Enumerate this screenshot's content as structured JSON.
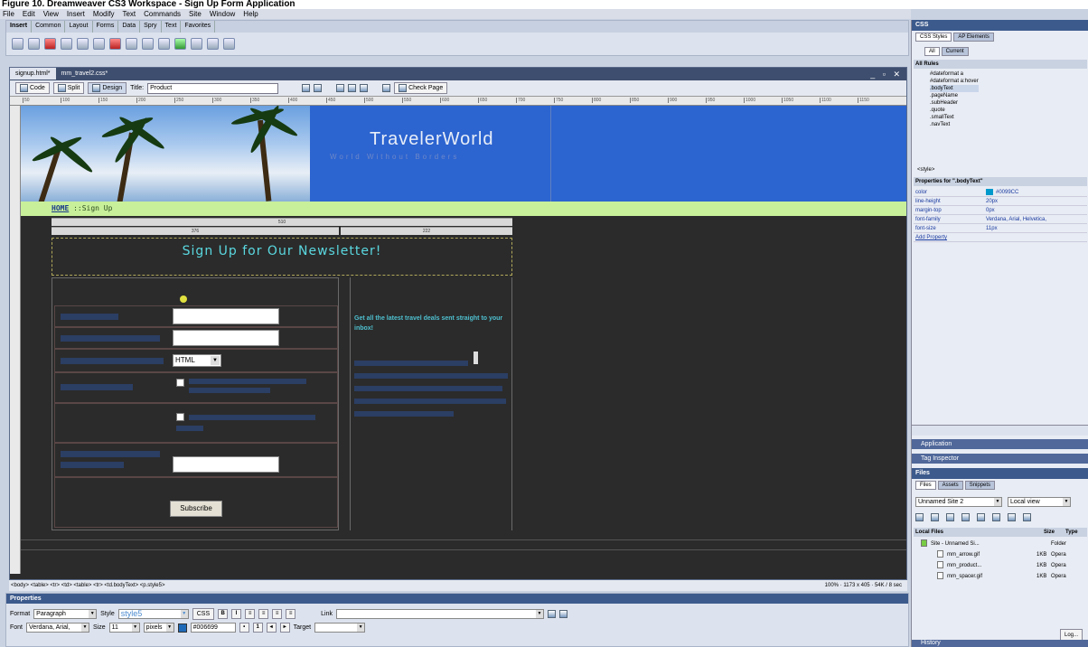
{
  "caption": "Figure 10. Dreamweaver CS3 Workspace - Sign Up Form Application",
  "menu": [
    "File",
    "Edit",
    "View",
    "Insert",
    "Modify",
    "Text",
    "Commands",
    "Site",
    "Window",
    "Help"
  ],
  "insert_tabs": [
    "Insert",
    "Common",
    "Layout",
    "Forms",
    "Data",
    "Spry",
    "Text",
    "Favorites"
  ],
  "doc_tabs": [
    "signup.html*",
    "mm_travel2.css*"
  ],
  "doc_toolbar": {
    "code": "Code",
    "split": "Split",
    "design": "Design",
    "title_label": "Title:",
    "title_value": "Product",
    "check_page": "Check Page"
  },
  "ruler_ticks": [
    "50",
    "100",
    "150",
    "200",
    "250",
    "300",
    "350",
    "400",
    "450",
    "500",
    "550",
    "600",
    "650",
    "700",
    "750",
    "800",
    "850",
    "900",
    "950",
    "1000",
    "1050",
    "1100",
    "1150"
  ],
  "banner": {
    "brand": "TravelerWorld",
    "tagline": "World Without Borders"
  },
  "nav": {
    "home": "HOME",
    "current": "::Sign Up"
  },
  "width_labels": {
    "total": "510",
    "left": "376",
    "right": "222"
  },
  "form": {
    "headline": "Sign Up for Our Newsletter!",
    "format_select": "HTML",
    "subscribe": "Subscribe"
  },
  "sidebar": {
    "promo": "Get all the latest travel deals sent straight to your inbox!"
  },
  "status": {
    "tags": "<body> <table> <tr> <td> <table> <tr> <td.bodyText> <p.style5>",
    "zoom": "100%",
    "size": "1173 x 405",
    "weight": "54K / 8 sec"
  },
  "properties": {
    "header": "Properties",
    "format_label": "Format",
    "format_value": "Paragraph",
    "style_label": "Style",
    "style_value": "style5",
    "css_button": "CSS",
    "link_label": "Link",
    "font_label": "Font",
    "font_value": "Verdana, Arial,",
    "size_label": "Size",
    "size_value": "11",
    "unit_value": "pixels",
    "color_value": "#006699",
    "target_label": "Target"
  },
  "css_panel": {
    "header": "CSS",
    "tabs": [
      "CSS Styles",
      "AP Elements"
    ],
    "mode_tabs": [
      "All",
      "Current"
    ],
    "all_rules": "All Rules",
    "rules": [
      "#dateformat a",
      "#dateformat a:hover",
      ".bodyText",
      ".pageName",
      ".subHeader",
      ".quote",
      ".smallText",
      ".navText"
    ],
    "style_tag": "<style>",
    "props_title": "Properties for \".bodyText\"",
    "props": [
      {
        "k": "color",
        "v": "#0099CC"
      },
      {
        "k": "line-height",
        "v": "20px"
      },
      {
        "k": "margin-top",
        "v": "0px"
      },
      {
        "k": "font-family",
        "v": "Verdana, Arial, Helvetica,"
      },
      {
        "k": "font-size",
        "v": "11px"
      }
    ],
    "add_property": "Add Property"
  },
  "panels": {
    "application": "Application",
    "tag_inspector": "Tag Inspector",
    "files": "Files",
    "history": "History"
  },
  "files_panel": {
    "tabs": [
      "Files",
      "Assets",
      "Snippets"
    ],
    "site": "Unnamed Site 2",
    "view": "Local view",
    "local_files": "Local Files",
    "size_col": "Size",
    "type_col": "Type",
    "rows": [
      {
        "name": "Site - Unnamed Si...",
        "size": "",
        "type": "Folder"
      },
      {
        "name": "mm_arrow.gif",
        "size": "1KB",
        "type": "Opera"
      },
      {
        "name": "mm_product...",
        "size": "1KB",
        "type": "Opera"
      },
      {
        "name": "mm_spacer.gif",
        "size": "1KB",
        "type": "Opera"
      }
    ],
    "log": "Log..."
  },
  "colors": {
    "banner_blue": "#2c64d0",
    "nav_green": "#c8f09a",
    "headline_cyan": "#5ad8e0",
    "panel_header": "#3c5a8c"
  }
}
